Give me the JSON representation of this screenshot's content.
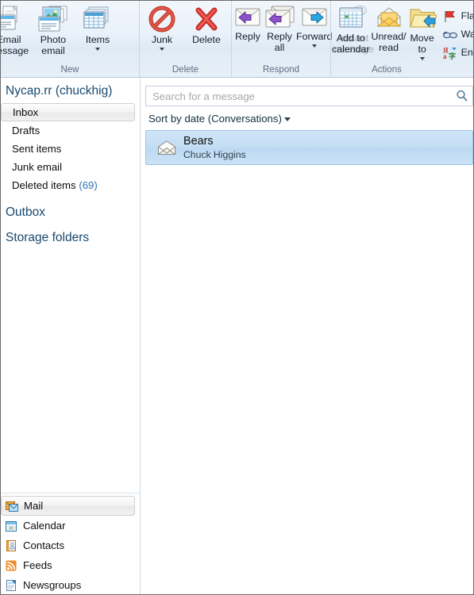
{
  "window": {
    "app": "Windows Live Mail"
  },
  "ribbon": {
    "groups": [
      {
        "label": "New",
        "buttons": [
          {
            "name": "email-message",
            "caption": "Email\nmessage",
            "icon": "email-message-icon",
            "dropdown": false,
            "disabled": false
          },
          {
            "name": "photo-email",
            "caption": "Photo\nemail",
            "icon": "photo-email-icon",
            "dropdown": false,
            "disabled": false
          },
          {
            "name": "items",
            "caption": "Items",
            "icon": "items-icon",
            "dropdown": true,
            "disabled": false
          }
        ]
      },
      {
        "label": "Delete",
        "buttons": [
          {
            "name": "junk",
            "caption": "Junk",
            "icon": "junk-icon",
            "dropdown": true,
            "disabled": false
          },
          {
            "name": "delete",
            "caption": "Delete",
            "icon": "delete-icon",
            "dropdown": false,
            "disabled": false
          }
        ]
      },
      {
        "label": "Respond",
        "buttons": [
          {
            "name": "reply",
            "caption": "Reply",
            "icon": "reply-icon",
            "dropdown": false,
            "disabled": false
          },
          {
            "name": "reply-all",
            "caption": "Reply\nall",
            "icon": "reply-all-icon",
            "dropdown": false,
            "disabled": false
          },
          {
            "name": "forward",
            "caption": "Forward",
            "icon": "forward-icon",
            "dropdown": true,
            "disabled": false
          },
          {
            "name": "instant-message",
            "caption": "Instant\nmessage",
            "icon": "instant-message-icon",
            "dropdown": false,
            "disabled": true
          }
        ]
      },
      {
        "label": "Actions",
        "buttons": [
          {
            "name": "add-to-calendar",
            "caption": "Add to\ncalendar",
            "icon": "calendar-icon",
            "dropdown": false,
            "disabled": false
          },
          {
            "name": "unread-read",
            "caption": "Unread/\nread",
            "icon": "unread-read-icon",
            "dropdown": false,
            "disabled": false
          },
          {
            "name": "move-to",
            "caption": "Move\nto",
            "icon": "move-to-icon",
            "dropdown": true,
            "disabled": false
          }
        ],
        "small_actions": [
          {
            "name": "flag",
            "caption": "Flag",
            "icon": "flag-icon"
          },
          {
            "name": "watch",
            "caption": "Watch",
            "icon": "watch-icon"
          },
          {
            "name": "encoding",
            "caption": "Encoding",
            "icon": "encoding-icon"
          }
        ]
      }
    ]
  },
  "sidebar": {
    "account_title": "Nycap.rr (chuckhig)",
    "folders": [
      {
        "label": "Inbox",
        "count": "",
        "selected": true
      },
      {
        "label": "Drafts",
        "count": "",
        "selected": false
      },
      {
        "label": "Sent items",
        "count": "",
        "selected": false
      },
      {
        "label": "Junk email",
        "count": "",
        "selected": false
      },
      {
        "label": "Deleted items",
        "count": "(69)",
        "selected": false
      }
    ],
    "groups": [
      {
        "label": "Outbox"
      },
      {
        "label": "Storage folders"
      }
    ],
    "nav": [
      {
        "label": "Mail",
        "icon": "mail-icon",
        "selected": true
      },
      {
        "label": "Calendar",
        "icon": "calendar-nav-icon",
        "selected": false
      },
      {
        "label": "Contacts",
        "icon": "contacts-icon",
        "selected": false
      },
      {
        "label": "Feeds",
        "icon": "feeds-icon",
        "selected": false
      },
      {
        "label": "Newsgroups",
        "icon": "newsgroups-icon",
        "selected": false
      }
    ]
  },
  "message_pane": {
    "search": {
      "value": "",
      "placeholder": "Search for a message",
      "icon": "search-icon"
    },
    "sort": {
      "label": "Sort by date (Conversations)"
    },
    "messages": [
      {
        "subject": "Bears",
        "from": "Chuck Higgins",
        "icon": "open-envelope-icon",
        "selected": true
      }
    ]
  },
  "colors": {
    "accent_blue": "#17486e",
    "count_blue": "#2a6fb5",
    "selection_blue": "#c3ddf4",
    "ribbon_bg": "#e9f1f9",
    "group_label": "#5b6d80"
  }
}
